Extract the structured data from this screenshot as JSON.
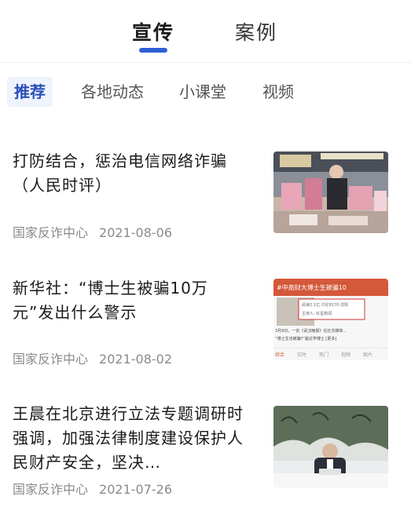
{
  "top_tabs": [
    {
      "label": "宣传",
      "active": true
    },
    {
      "label": "案例",
      "active": false
    }
  ],
  "sub_tabs": [
    {
      "label": "推荐",
      "active": true
    },
    {
      "label": "各地动态",
      "active": false
    },
    {
      "label": "小课堂",
      "active": false
    },
    {
      "label": "视频",
      "active": false
    }
  ],
  "articles": [
    {
      "title": "打防结合，惩治电信网络诈骗（人民时评）",
      "source": "国家反诈中心",
      "date": "2021-08-06"
    },
    {
      "title": "新华社：“博士生被骗10万元”发出什么警示",
      "source": "国家反诈中心",
      "date": "2021-08-02",
      "thumb_text": {
        "headline": "#中南财大博士生被骗10",
        "stats": "阅读2.1亿  讨论9170  详情",
        "host": "主持人: 红星新闻",
        "body1": "3月9日，一名《武汉晚报》在社交媒体...",
        "body2": "“博士生也被骗?”最近学博士 [更多]",
        "tabs": [
          "综合",
          "实时",
          "热门",
          "视频",
          "图片"
        ]
      }
    },
    {
      "title": "王晨在北京进行立法专题调研时强调，加强法律制度建设保护人民财产安全，坚决…",
      "source": "国家反诈中心",
      "date": "2021-07-26"
    }
  ],
  "colors": {
    "accent": "#2f5fd6",
    "meta": "#8a8a8a"
  }
}
